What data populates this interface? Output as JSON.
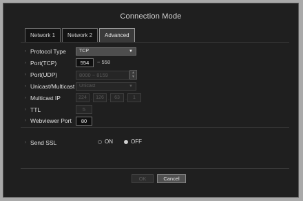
{
  "dialog": {
    "title": "Connection Mode"
  },
  "tabs": [
    {
      "label": "Network 1"
    },
    {
      "label": "Network 2"
    },
    {
      "label": "Advanced"
    }
  ],
  "protocol_type": {
    "label": "Protocol Type",
    "value": "TCP"
  },
  "port_tcp": {
    "label": "Port(TCP)",
    "start": "554",
    "end": "558"
  },
  "port_udp": {
    "label": "Port(UDP)",
    "value": "8000 ~ 8159"
  },
  "unicast_multicast": {
    "label": "Unicast/Multicast",
    "value": "Unicast"
  },
  "multicast_ip": {
    "label": "Multicast IP",
    "octets": [
      "224",
      "126",
      "63",
      "1"
    ]
  },
  "ttl": {
    "label": "TTL",
    "value": "5"
  },
  "webviewer_port": {
    "label": "Webviewer Port",
    "value": "80"
  },
  "send_ssl": {
    "label": "Send SSL",
    "on_label": "ON",
    "off_label": "OFF",
    "selected": "OFF"
  },
  "buttons": {
    "ok": "OK",
    "cancel": "Cancel"
  },
  "dash": "~"
}
